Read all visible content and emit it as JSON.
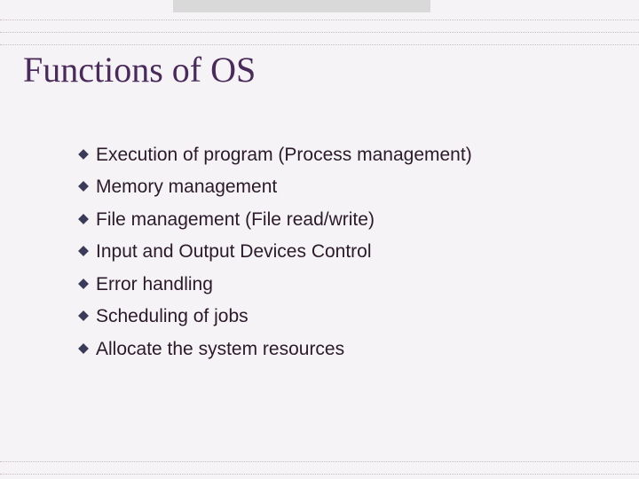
{
  "title": "Functions of OS",
  "bullets": [
    "Execution of program (Process management)",
    "Memory management",
    "File management (File read/write)",
    "Input and Output Devices Control",
    "Error handling",
    "Scheduling of jobs",
    "Allocate the system resources"
  ]
}
